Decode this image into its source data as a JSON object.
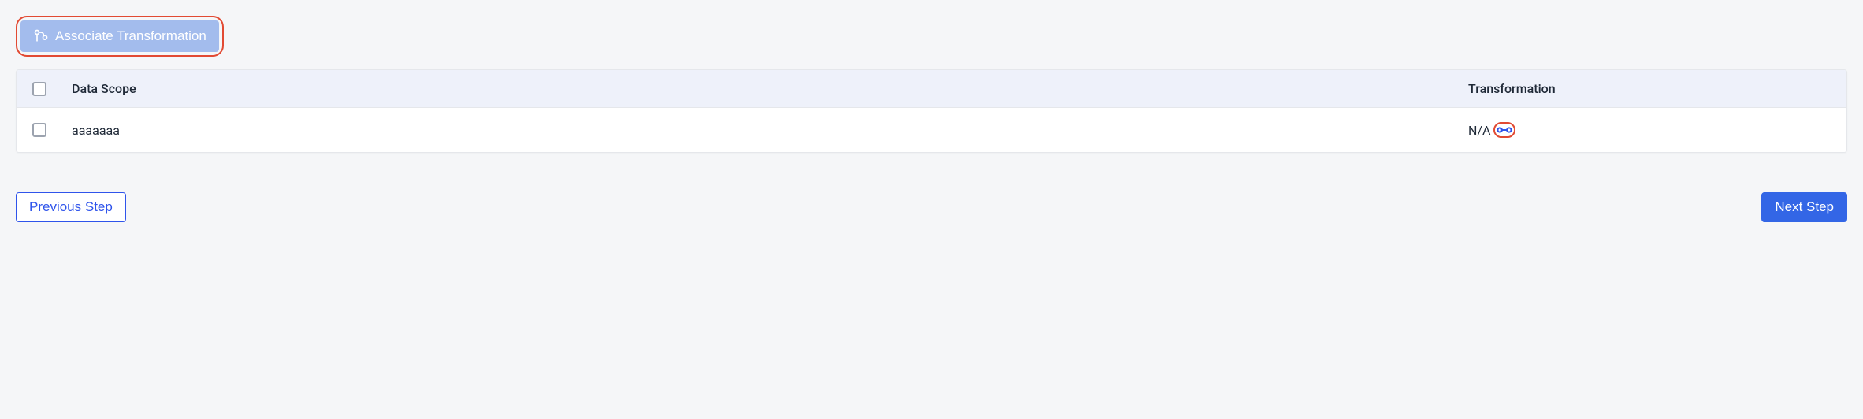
{
  "toolbar": {
    "associate_label": "Associate Transformation"
  },
  "table": {
    "headers": {
      "data_scope": "Data Scope",
      "transformation": "Transformation"
    },
    "rows": [
      {
        "data_scope": "aaaaaaa",
        "transformation": "N/A"
      }
    ]
  },
  "footer": {
    "previous_label": "Previous Step",
    "next_label": "Next Step"
  }
}
